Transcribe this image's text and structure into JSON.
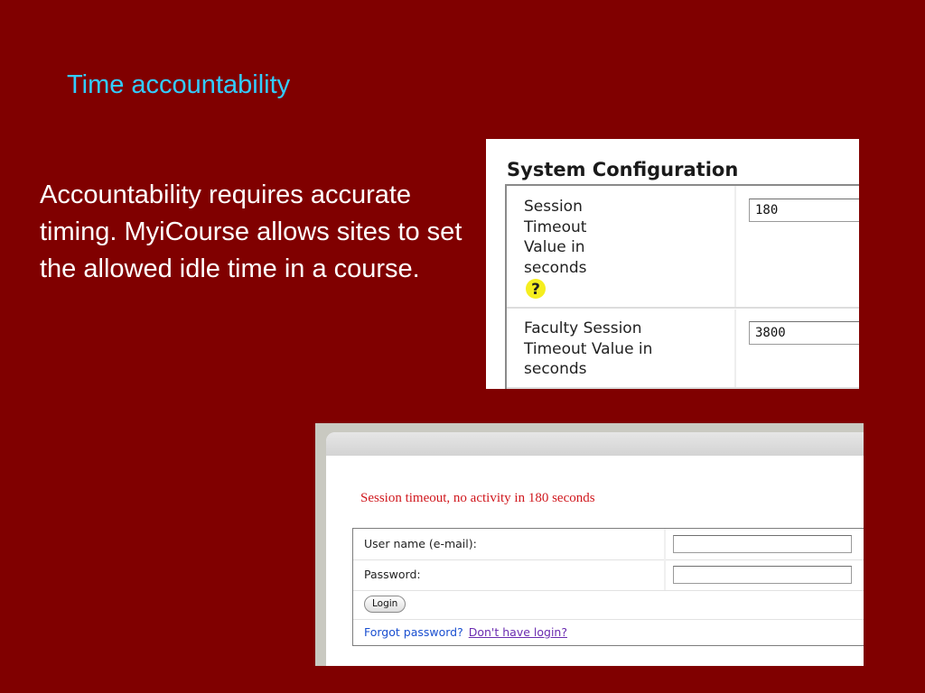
{
  "slide": {
    "title": "Time accountability",
    "body": "Accountability requires accurate timing. MyiCourse allows sites to set the allowed idle time in a course."
  },
  "system_config": {
    "title": "System Configuration",
    "rows": [
      {
        "label": "Session Timeout Value in seconds",
        "value": "180",
        "help_icon": "question-mark-icon"
      },
      {
        "label": "Faculty Session Timeout Value in seconds",
        "value": "3800"
      }
    ]
  },
  "login": {
    "message": "Session timeout, no activity in 180 seconds",
    "username_label": "User name (e-mail):",
    "username_value": "",
    "password_label": "Password:",
    "password_value": "",
    "login_button": "Login",
    "forgot_link": "Forgot password?",
    "no_login_link": "Don't have login?"
  },
  "colors": {
    "background": "#800000",
    "title": "#33ccff",
    "body_text": "#ffffff",
    "error_text": "#d0181e",
    "link": "#1a4fd0",
    "visited_link": "#6a2bb0"
  }
}
